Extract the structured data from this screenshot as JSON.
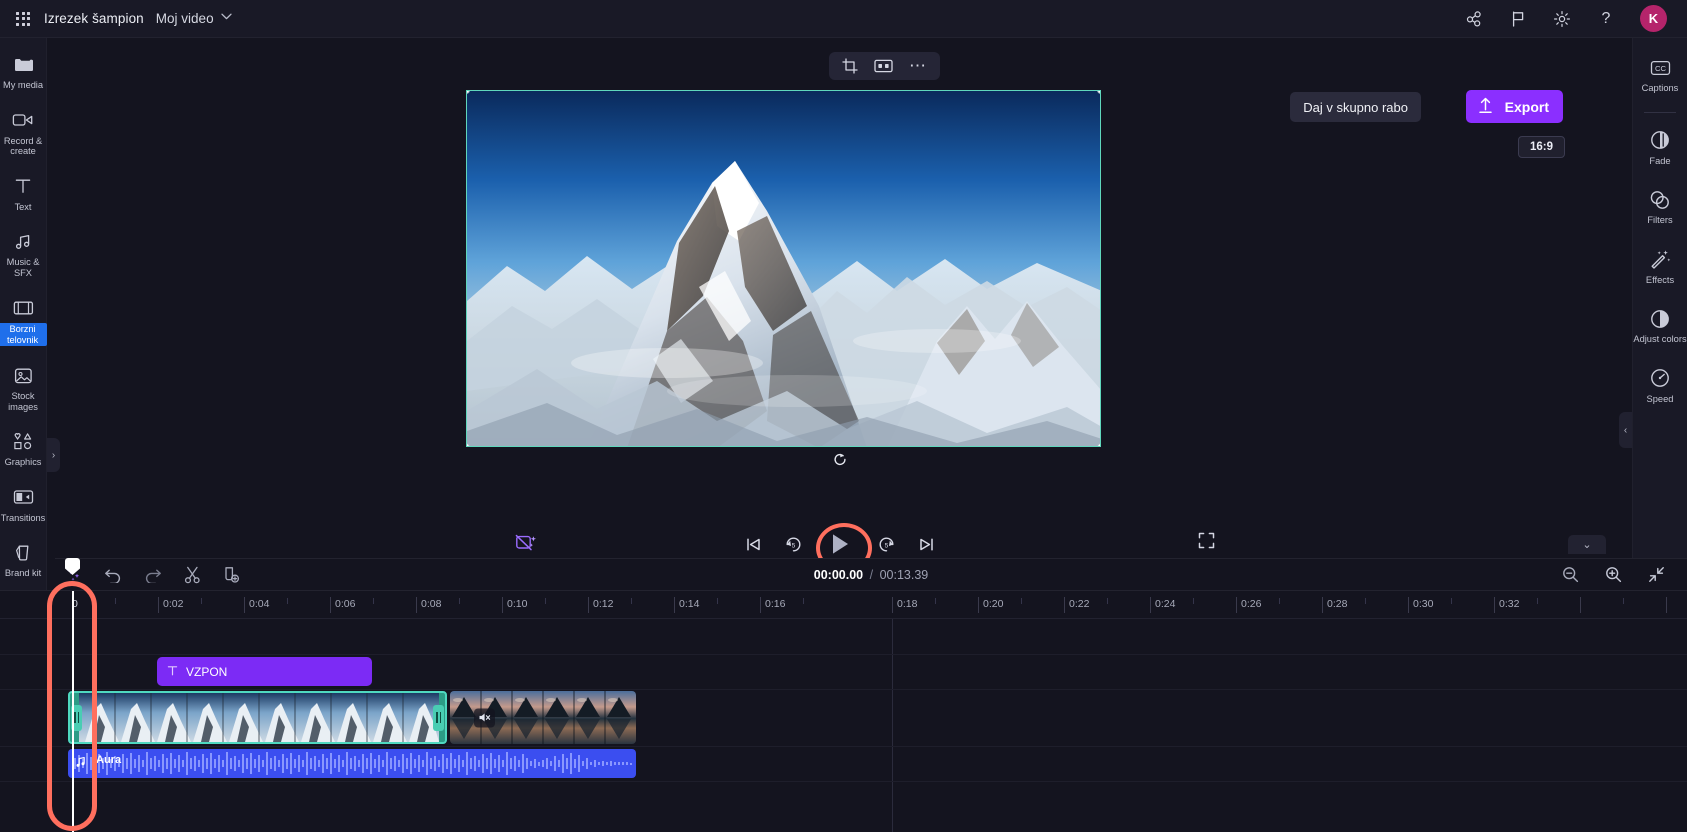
{
  "app": {
    "waffle_label": "app-launcher",
    "project_name": "Izrezek šampion",
    "project_subtitle": "Moj video",
    "chevron": "⌄"
  },
  "topbar": {
    "icons": [
      {
        "name": "share-nodes-icon",
        "glyph": "share"
      },
      {
        "name": "flag-icon",
        "glyph": "flag"
      },
      {
        "name": "gear-icon",
        "glyph": "gear"
      },
      {
        "name": "help-icon",
        "glyph": "?"
      }
    ],
    "avatar_initial": "K"
  },
  "left_rail": {
    "items": [
      {
        "label": "My media",
        "icon": "folder-icon",
        "highlighted": false
      },
      {
        "label": "Record & create",
        "icon": "record-camera-icon",
        "highlighted": false
      },
      {
        "label": "Text",
        "icon": "text-t-icon",
        "highlighted": false
      },
      {
        "label": "Music & SFX",
        "icon": "music-note-icon",
        "highlighted": false
      },
      {
        "label": "Borzni telovnik",
        "icon": "film-strip-icon",
        "highlighted": true
      },
      {
        "label": "Stock images",
        "icon": "image-icon",
        "highlighted": false
      },
      {
        "label": "Graphics",
        "icon": "shapes-icon",
        "highlighted": false
      },
      {
        "label": "Transitions",
        "icon": "transitions-icon",
        "highlighted": false
      },
      {
        "label": "Brand kit",
        "icon": "brand-kit-icon",
        "highlighted": false
      }
    ],
    "expand_glyph": "›"
  },
  "right_rail": {
    "items": [
      {
        "label": "Captions",
        "icon": "cc-icon"
      },
      {
        "label": "Fade",
        "icon": "fade-icon"
      },
      {
        "label": "Filters",
        "icon": "filters-icon"
      },
      {
        "label": "Effects",
        "icon": "effects-wand-icon"
      },
      {
        "label": "Adjust colors",
        "icon": "adjust-colors-icon"
      },
      {
        "label": "Speed",
        "icon": "speedometer-icon"
      }
    ],
    "collapse_glyph": "‹"
  },
  "preview": {
    "float_tools": [
      {
        "name": "crop-icon",
        "label": "Crop"
      },
      {
        "name": "fit-fill-icon",
        "label": "Fit"
      },
      {
        "name": "more-options-icon",
        "label": "More"
      }
    ],
    "share_label": "Daj v skupno rabo",
    "export_label": "Export",
    "ratio_label": "16:9",
    "collapse_glyph": "⌄"
  },
  "player": {
    "magic_icon": "auto-compose-icon",
    "controls": [
      {
        "name": "skip-to-start-button",
        "label": "Skip to start"
      },
      {
        "name": "rewind-5-button",
        "label": "Back 5s"
      },
      {
        "name": "play-button",
        "label": "Play"
      },
      {
        "name": "forward-5-button",
        "label": "Forward 5s"
      },
      {
        "name": "skip-to-end-button",
        "label": "Skip to end"
      }
    ],
    "fullscreen_icon": "fullscreen-icon"
  },
  "timeline_toolbar": {
    "tools": [
      {
        "name": "magic-tools-button",
        "label": "Magic tools"
      },
      {
        "name": "undo-button",
        "label": "Undo"
      },
      {
        "name": "redo-button",
        "label": "Redo"
      },
      {
        "name": "split-scissors-button",
        "label": "Split"
      },
      {
        "name": "duplicate-button",
        "label": "Duplicate"
      }
    ],
    "current_time": "00:00.00",
    "separator": "/",
    "total_time": "00:13.39",
    "right_tools": [
      {
        "name": "zoom-out-button",
        "label": "Zoom out"
      },
      {
        "name": "zoom-in-button",
        "label": "Zoom in"
      },
      {
        "name": "fit-timeline-button",
        "label": "Fit to timeline"
      }
    ]
  },
  "timeline": {
    "zero_label": "0",
    "tick_labels": [
      "0:02",
      "0:04",
      "0:06",
      "0:08",
      "0:10",
      "0:12",
      "0:14",
      "0:16",
      "0:18",
      "0:20",
      "0:22",
      "0:24",
      "0:26",
      "0:28",
      "0:30",
      "0:32"
    ],
    "text_clip": {
      "label": "VZPON",
      "icon": "text-t-icon"
    },
    "video_clips": [
      {
        "name": "video-clip-mountain",
        "selected": true
      },
      {
        "name": "video-clip-lake",
        "selected": false,
        "badge": "mute-icon"
      }
    ],
    "audio_clip": {
      "label": "Aura",
      "icon": "music-note-icon"
    },
    "playhead_time": "0"
  },
  "annotation": {
    "highlight_color": "#ff6f5e",
    "play_button_highlight": true,
    "playhead_highlight": true
  }
}
